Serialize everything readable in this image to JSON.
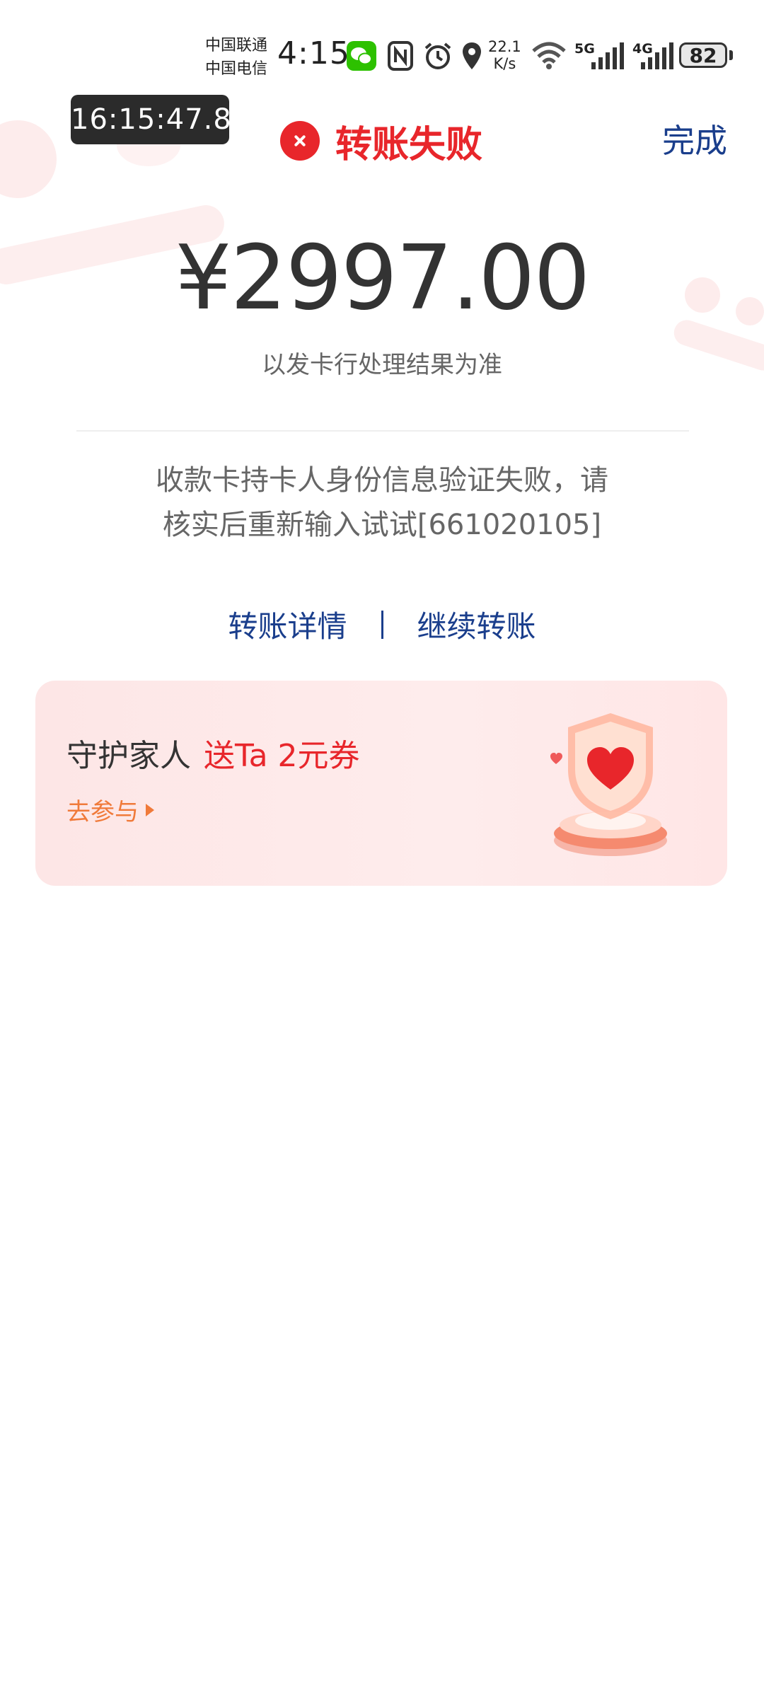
{
  "status_bar": {
    "carrier1": "中国联通",
    "carrier2": "中国电信",
    "time": "4:15",
    "net_speed_value": "22.1",
    "net_speed_unit": "K/s",
    "signal1_label": "5G",
    "signal2_label": "4G",
    "battery": "82",
    "icons": [
      "wechat-icon",
      "nfc-icon",
      "alarm-icon",
      "location-icon",
      "wifi-icon",
      "signal-icon",
      "battery-icon"
    ]
  },
  "timer": "16:15:47.8",
  "header": {
    "status_title": "转账失败",
    "done_label": "完成"
  },
  "amount": {
    "value": "¥2997.00",
    "note": "以发卡行处理结果为准"
  },
  "error": {
    "line1": "收款卡持卡人身份信息验证失败，请",
    "line2": "核实后重新输入试试[661020105]"
  },
  "links": {
    "details": "转账详情",
    "continue": "继续转账"
  },
  "promo": {
    "title": "守护家人",
    "highlight": "送Ta 2元券",
    "action": "去参与"
  },
  "colors": {
    "accent_red": "#e8262b",
    "link_blue": "#1a3e8c",
    "promo_orange": "#f07a3a"
  }
}
